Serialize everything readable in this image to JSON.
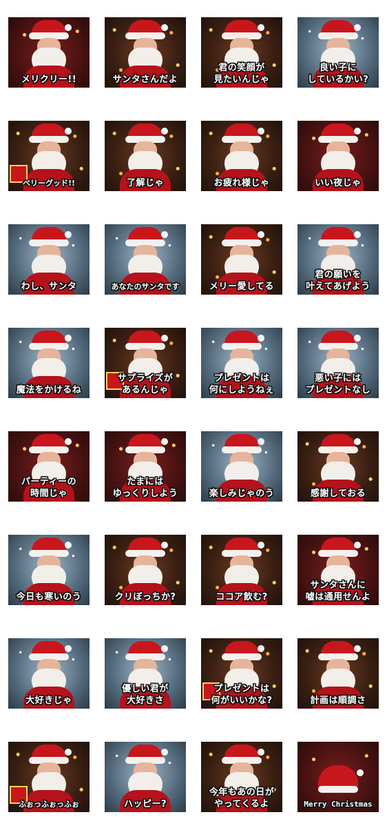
{
  "stickers": [
    {
      "caption": "メリクリー!!",
      "theme": "red"
    },
    {
      "caption": "サンタさんだよ",
      "theme": "warm"
    },
    {
      "caption": "君の笑顔が\n見たいんじゃ",
      "theme": "warm"
    },
    {
      "caption": "良い子に\nしているかい?",
      "theme": "snow"
    },
    {
      "caption": "ベリーグッド!!",
      "theme": "gift"
    },
    {
      "caption": "了解じゃ",
      "theme": "warm"
    },
    {
      "caption": "お疲れ様じゃ",
      "theme": "warm"
    },
    {
      "caption": "いい夜じゃ",
      "theme": "red"
    },
    {
      "caption": "わし、サンタ",
      "theme": "snow"
    },
    {
      "caption": "あなたのサンタです",
      "theme": "snow"
    },
    {
      "caption": "メリー愛してる",
      "theme": "warm"
    },
    {
      "caption": "君の願いを\n叶えてあげよう",
      "theme": "snow"
    },
    {
      "caption": "魔法をかけるね",
      "theme": "snow"
    },
    {
      "caption": "サプライズが\nあるんじゃ",
      "theme": "gift"
    },
    {
      "caption": "プレゼントは\n何にしようねぇ",
      "theme": "snow"
    },
    {
      "caption": "悪い子には\nプレゼントなし",
      "theme": "snow"
    },
    {
      "caption": "パーティーの\n時間じゃ",
      "theme": "red"
    },
    {
      "caption": "たまには\nゆっくりしよう",
      "theme": "red"
    },
    {
      "caption": "楽しみじゃのう",
      "theme": "snow"
    },
    {
      "caption": "感謝しておる",
      "theme": "warm"
    },
    {
      "caption": "今日も寒いのう",
      "theme": "snow"
    },
    {
      "caption": "クリぼっちか?",
      "theme": "warm"
    },
    {
      "caption": "ココア飲む?",
      "theme": "warm"
    },
    {
      "caption": "サンタさんに\n嘘は通用せんよ",
      "theme": "red"
    },
    {
      "caption": "大好きじゃ",
      "theme": "snow"
    },
    {
      "caption": "優しい君が\n大好きさ",
      "theme": "snow"
    },
    {
      "caption": "プレゼントは\n何がいいかな?",
      "theme": "gift"
    },
    {
      "caption": "計画は順調さ",
      "theme": "warm"
    },
    {
      "caption": "ふぉっふぉっふぉ",
      "theme": "gift"
    },
    {
      "caption": "ハッピー?",
      "theme": "snow"
    },
    {
      "caption": "今年もあの日が\nやってくるよ",
      "theme": "warm"
    },
    {
      "caption": "Merry Christmas",
      "theme": "hatonly"
    }
  ]
}
